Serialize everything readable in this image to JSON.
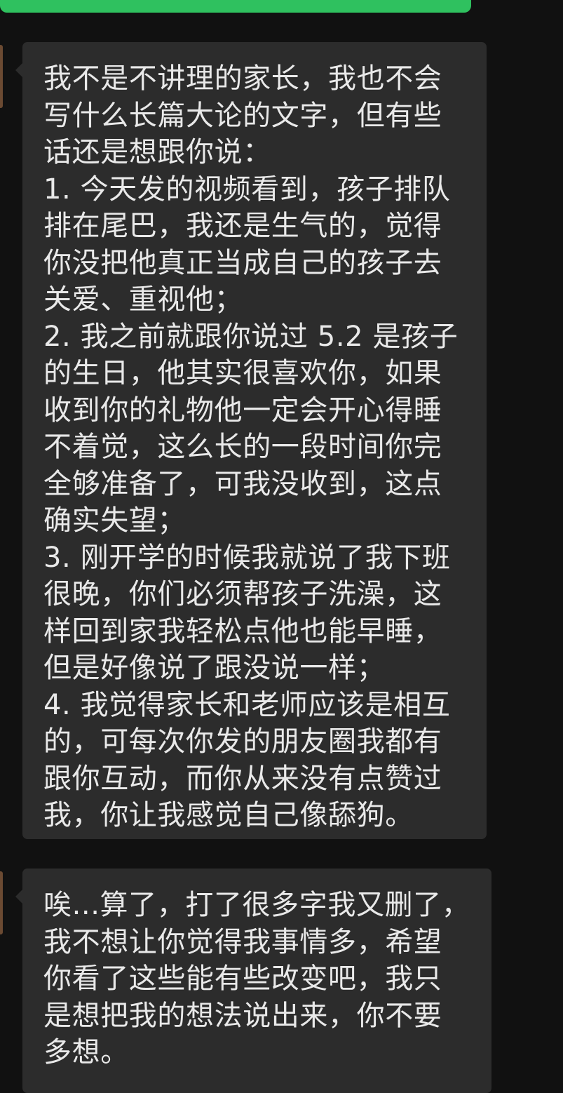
{
  "messages": [
    {
      "lines": [
        "我不是不讲理的家长，我也不会",
        "写什么长篇大论的文字，但有些",
        "话还是想跟你说：",
        "1. 今天发的视频看到，孩子排队",
        "排在尾巴，我还是生气的，觉得",
        "你没把他真正当成自己的孩子去",
        "关爱、重视他；",
        "2. 我之前就跟你说过 5.2 是孩子",
        "的生日，他其实很喜欢你，如果",
        "收到你的礼物他一定会开心得睡",
        "不着觉，这么长的一段时间你完",
        "全够准备了，可我没收到，这点",
        "确实失望；",
        "3. 刚开学的时候我就说了我下班",
        "很晚，你们必须帮孩子洗澡，这",
        "样回到家我轻松点他也能早睡，",
        "但是好像说了跟没说一样；",
        "4. 我觉得家长和老师应该是相互",
        "的，可每次你发的朋友圈我都有",
        "跟你互动，而你从来没有点赞过",
        "我，你让我感觉自己像舔狗。"
      ]
    },
    {
      "lines": [
        "唉...算了，打了很多字我又删了，",
        "我不想让你觉得我事情多，希望",
        "你看了这些能有些改变吧，我只",
        "是想把我的想法说出来，你不要",
        "多想。"
      ]
    }
  ]
}
